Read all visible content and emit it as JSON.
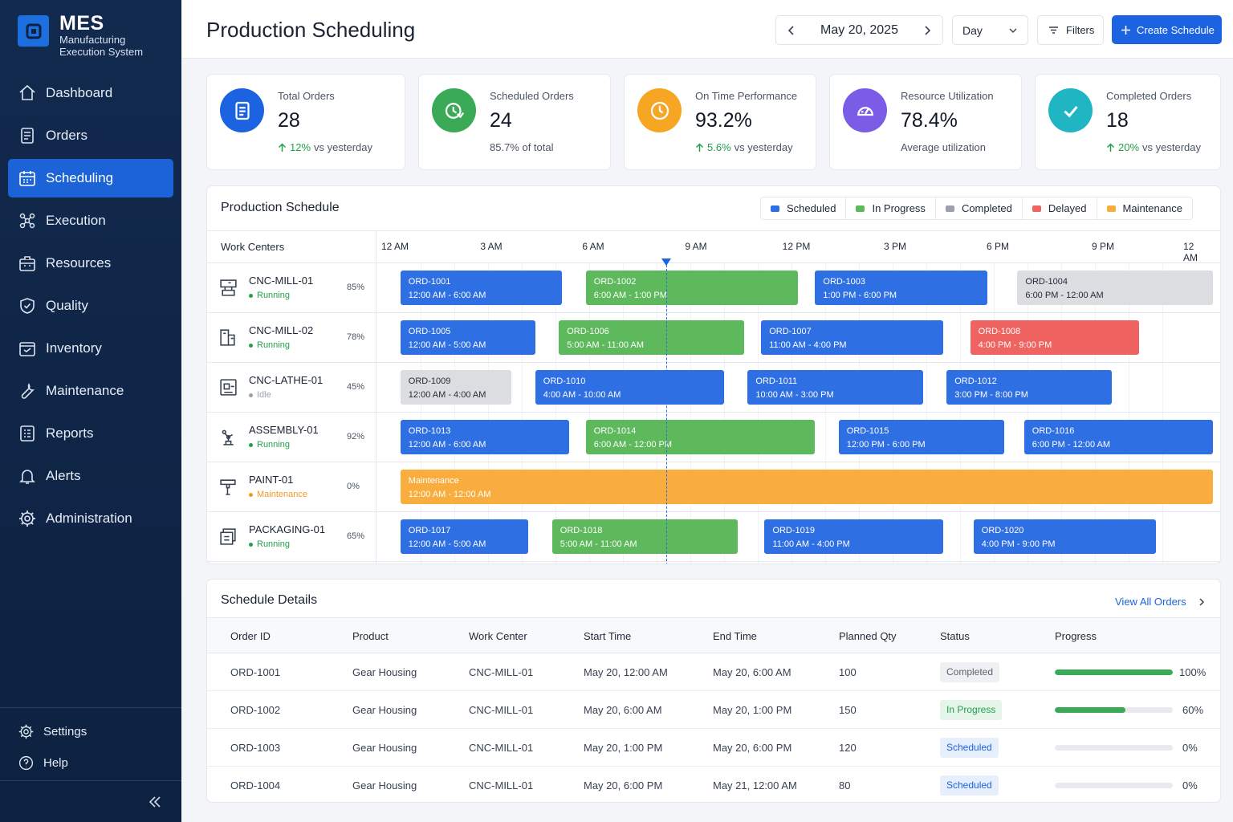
{
  "brand": {
    "title": "MES",
    "subtitle_line1": "Manufacturing",
    "subtitle_line2": "Execution System"
  },
  "nav": [
    {
      "label": "Dashboard",
      "icon": "home-icon"
    },
    {
      "label": "Orders",
      "icon": "clipboard-icon"
    },
    {
      "label": "Scheduling",
      "icon": "calendar-icon",
      "active": true
    },
    {
      "label": "Execution",
      "icon": "nodes-icon"
    },
    {
      "label": "Resources",
      "icon": "briefcase-icon"
    },
    {
      "label": "Quality",
      "icon": "shield-check-icon"
    },
    {
      "label": "Inventory",
      "icon": "box-icon"
    },
    {
      "label": "Maintenance",
      "icon": "wrench-icon"
    },
    {
      "label": "Reports",
      "icon": "report-icon"
    },
    {
      "label": "Alerts",
      "icon": "bell-icon"
    },
    {
      "label": "Administration",
      "icon": "gear-icon"
    }
  ],
  "bottom_nav": [
    {
      "label": "Settings",
      "icon": "gear-icon"
    },
    {
      "label": "Help",
      "icon": "help-icon"
    }
  ],
  "header": {
    "title": "Production Scheduling",
    "date": "May 20, 2025",
    "view": "Day",
    "filters_label": "Filters",
    "create_label": "Create Schedule"
  },
  "kpis": [
    {
      "label": "Total Orders",
      "value": "28",
      "trend": "12%",
      "trend_text": "vs yesterday",
      "color": "#1b63e0",
      "icon": "clipboard-icon"
    },
    {
      "label": "Scheduled Orders",
      "value": "24",
      "sub": "85.7% of total",
      "color": "#3aaa56",
      "icon": "clock-calendar-icon"
    },
    {
      "label": "On Time Performance",
      "value": "93.2%",
      "trend": "5.6%",
      "trend_text": "vs yesterday",
      "color": "#f6a623",
      "icon": "clock-icon"
    },
    {
      "label": "Resource Utilization",
      "value": "78.4%",
      "sub": "Average utilization",
      "color": "#7b5ce6",
      "icon": "gauge-icon"
    },
    {
      "label": "Completed Orders",
      "value": "18",
      "trend": "20%",
      "trend_text": "vs yesterday",
      "color": "#1fb5c2",
      "icon": "check-icon"
    }
  ],
  "colors": {
    "scheduled": "#2f6fe4",
    "in_progress": "#5db95c",
    "completed": "#dcdde0",
    "delayed": "#ef6461",
    "maintenance": "#f8ad3e"
  },
  "gantt": {
    "title": "Production Schedule",
    "legend": [
      {
        "label": "Scheduled",
        "color": "#2f6fe4"
      },
      {
        "label": "In Progress",
        "color": "#5db95c"
      },
      {
        "label": "Completed",
        "color": "#9aa1ac"
      },
      {
        "label": "Delayed",
        "color": "#ef6461"
      },
      {
        "label": "Maintenance",
        "color": "#f8ad3e"
      }
    ],
    "wc_header": "Work Centers",
    "ticks": [
      "12 AM",
      "3 AM",
      "6 AM",
      "9 AM",
      "12 PM",
      "3 PM",
      "6 PM",
      "9 PM",
      "12 AM"
    ],
    "rows": [
      {
        "name": "CNC-MILL-01",
        "status": "Running",
        "status_color": "#23a04a",
        "util": "85%",
        "icon": "mill-icon",
        "bars": [
          {
            "id": "ORD-1001",
            "time": "12:00 AM - 6:00 AM",
            "start": 0.4,
            "end": 5.2,
            "type": "scheduled"
          },
          {
            "id": "ORD-1002",
            "time": "6:00 AM - 1:00 PM",
            "start": 5.9,
            "end": 12.2,
            "type": "in_progress"
          },
          {
            "id": "ORD-1003",
            "time": "1:00 PM - 6:00 PM",
            "start": 12.7,
            "end": 17.8,
            "type": "scheduled"
          },
          {
            "id": "ORD-1004",
            "time": "6:00 PM - 12:00 AM",
            "start": 18.7,
            "end": 24.5,
            "type": "completed"
          }
        ]
      },
      {
        "name": "CNC-MILL-02",
        "status": "Running",
        "status_color": "#23a04a",
        "util": "78%",
        "icon": "mill2-icon",
        "bars": [
          {
            "id": "ORD-1005",
            "time": "12:00 AM - 5:00 AM",
            "start": 0.4,
            "end": 4.4,
            "type": "scheduled"
          },
          {
            "id": "ORD-1006",
            "time": "5:00 AM - 11:00 AM",
            "start": 5.1,
            "end": 10.6,
            "type": "in_progress"
          },
          {
            "id": "ORD-1007",
            "time": "11:00 AM - 4:00 PM",
            "start": 11.1,
            "end": 16.5,
            "type": "scheduled"
          },
          {
            "id": "ORD-1008",
            "time": "4:00 PM - 9:00 PM",
            "start": 17.3,
            "end": 22.3,
            "type": "delayed"
          }
        ]
      },
      {
        "name": "CNC-LATHE-01",
        "status": "Idle",
        "status_color": "#9aa1ac",
        "util": "45%",
        "icon": "lathe-icon",
        "bars": [
          {
            "id": "ORD-1009",
            "time": "12:00 AM - 4:00 AM",
            "start": 0.4,
            "end": 3.7,
            "type": "completed"
          },
          {
            "id": "ORD-1010",
            "time": "4:00 AM - 10:00 AM",
            "start": 4.4,
            "end": 10.0,
            "type": "scheduled"
          },
          {
            "id": "ORD-1011",
            "time": "10:00 AM - 3:00 PM",
            "start": 10.7,
            "end": 15.9,
            "type": "scheduled"
          },
          {
            "id": "ORD-1012",
            "time": "3:00 PM - 8:00 PM",
            "start": 16.6,
            "end": 21.5,
            "type": "scheduled"
          }
        ]
      },
      {
        "name": "ASSEMBLY-01",
        "status": "Running",
        "status_color": "#23a04a",
        "util": "92%",
        "icon": "robot-arm-icon",
        "bars": [
          {
            "id": "ORD-1013",
            "time": "12:00 AM - 6:00 AM",
            "start": 0.4,
            "end": 5.4,
            "type": "scheduled"
          },
          {
            "id": "ORD-1014",
            "time": "6:00 AM - 12:00 PM",
            "start": 5.9,
            "end": 12.7,
            "type": "in_progress"
          },
          {
            "id": "ORD-1015",
            "time": "12:00 PM - 6:00 PM",
            "start": 13.4,
            "end": 18.3,
            "type": "scheduled"
          },
          {
            "id": "ORD-1016",
            "time": "6:00 PM - 12:00 AM",
            "start": 18.9,
            "end": 24.5,
            "type": "scheduled"
          }
        ]
      },
      {
        "name": "PAINT-01",
        "status": "Maintenance",
        "status_color": "#f29a1f",
        "util": "0%",
        "icon": "spray-gun-icon",
        "bars": [
          {
            "id": "Maintenance",
            "time": "12:00 AM - 12:00 AM",
            "start": 0.4,
            "end": 24.5,
            "type": "maintenance"
          }
        ]
      },
      {
        "name": "PACKAGING-01",
        "status": "Running",
        "status_color": "#23a04a",
        "util": "65%",
        "icon": "package-icon",
        "bars": [
          {
            "id": "ORD-1017",
            "time": "12:00 AM - 5:00 AM",
            "start": 0.4,
            "end": 4.2,
            "type": "scheduled"
          },
          {
            "id": "ORD-1018",
            "time": "5:00 AM - 11:00 AM",
            "start": 4.9,
            "end": 10.4,
            "type": "in_progress"
          },
          {
            "id": "ORD-1019",
            "time": "11:00 AM - 4:00 PM",
            "start": 11.2,
            "end": 16.5,
            "type": "scheduled"
          },
          {
            "id": "ORD-1020",
            "time": "4:00 PM - 9:00 PM",
            "start": 17.4,
            "end": 22.8,
            "type": "scheduled"
          }
        ]
      }
    ]
  },
  "details": {
    "title": "Schedule Details",
    "view_all": "View All Orders",
    "columns": [
      "Order ID",
      "Product",
      "Work Center",
      "Start Time",
      "End Time",
      "Planned Qty",
      "Status",
      "Progress"
    ],
    "rows": [
      {
        "order": "ORD-1001",
        "product": "Gear Housing",
        "wc": "CNC-MILL-01",
        "start": "May 20, 12:00 AM",
        "end": "May 20, 6:00 AM",
        "qty": "100",
        "status": "Completed",
        "progress": 1.0,
        "progress_text": "100%"
      },
      {
        "order": "ORD-1002",
        "product": "Gear Housing",
        "wc": "CNC-MILL-01",
        "start": "May 20, 6:00 AM",
        "end": "May 20, 1:00 PM",
        "qty": "150",
        "status": "In Progress",
        "progress": 0.6,
        "progress_text": "60%"
      },
      {
        "order": "ORD-1003",
        "product": "Gear Housing",
        "wc": "CNC-MILL-01",
        "start": "May 20, 1:00 PM",
        "end": "May 20, 6:00 PM",
        "qty": "120",
        "status": "Scheduled",
        "progress": 0,
        "progress_text": "0%"
      },
      {
        "order": "ORD-1004",
        "product": "Gear Housing",
        "wc": "CNC-MILL-01",
        "start": "May 20, 6:00 PM",
        "end": "May 21, 12:00 AM",
        "qty": "80",
        "status": "Scheduled",
        "progress": 0,
        "progress_text": "0%"
      }
    ]
  }
}
